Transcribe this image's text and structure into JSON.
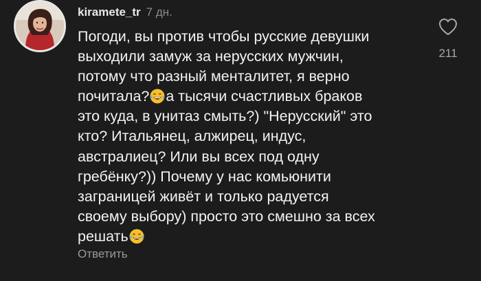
{
  "comment": {
    "username": "kiramete_tr",
    "time": "7 дн.",
    "text_part1": "Погоди, вы против чтобы русские девушки\nвыходили замуж за нерусских мужчин,\nпотому что разный менталитет, я верно\nпочитала?",
    "text_part2": "а тысячи счастливых браков\nэто куда, в унитаз смыть?) \"Нерусский\" это\nкто? Итальянец, алжирец, индус,\nавстралиец? Или вы всех под одну\nгребёнку?)) Почему у нас комьюнити\nзаграницей живёт и только радуется\nсвоему выбору) просто это смешно за всех\nрешать",
    "emoji_icon": "face-with-tears-of-joy-icon",
    "reply_label": "Ответить"
  },
  "likes": {
    "icon": "heart-outline-icon",
    "count": "211"
  },
  "colors": {
    "background": "#1c1c1c",
    "text": "#f3f3f3",
    "muted": "#8a8a8a"
  }
}
